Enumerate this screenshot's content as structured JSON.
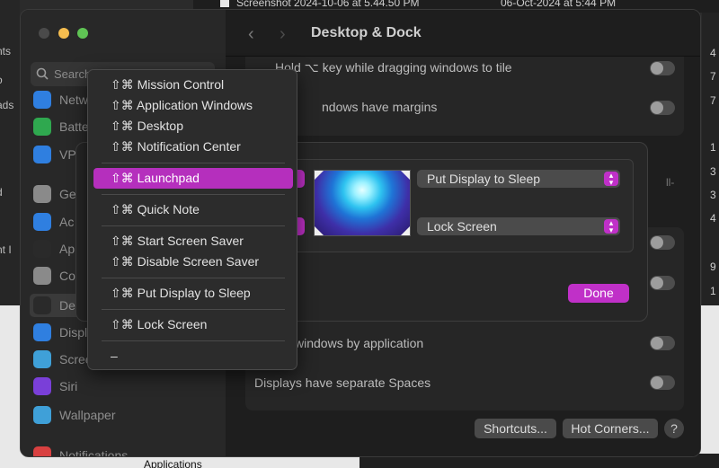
{
  "background": {
    "top_file_name": "Screenshot 2024-10-06 at 5.44.50 PM",
    "top_file_date": "06-Oct-2024 at 5:44 PM",
    "left_fragments": [
      "nts",
      "o",
      "ads",
      "d",
      "nt I"
    ],
    "right_digits": [
      "4",
      "7",
      "7",
      "1",
      "3",
      "3",
      "4",
      "9",
      "1"
    ],
    "applications_label": "Applications"
  },
  "window": {
    "title": "Desktop & Dock",
    "search_placeholder": "Search",
    "sidebar_items": [
      {
        "label": "Netw",
        "color": "#2f7fe0"
      },
      {
        "label": "Batte",
        "color": "#2fa84f"
      },
      {
        "label": "VPN",
        "color": "#2f7fe0"
      },
      {
        "label": "Ge",
        "color": "#8a8a8a"
      },
      {
        "label": "Ac",
        "color": "#2f7fe0"
      },
      {
        "label": "Ap",
        "color": "#2a2a2a"
      },
      {
        "label": "Co",
        "color": "#8a8a8a"
      },
      {
        "label": "De",
        "color": "#2a2a2a"
      },
      {
        "label": "Displ",
        "color": "#2f7fe0"
      },
      {
        "label": "Scree",
        "color": "#3fa0d8"
      },
      {
        "label": "Siri",
        "color": "#7a3fd8"
      },
      {
        "label": "Wallpaper",
        "color": "#3fa0d8"
      },
      {
        "label": "Notifications",
        "color": "#d84040"
      }
    ],
    "settings_rows": {
      "hold_key": "Hold ⌥ key while dragging windows to tile",
      "margins": "ndows have margins",
      "truncated_right": "ll-",
      "group_by_app": "windows by application",
      "separate_spaces": "Displays have separate Spaces"
    },
    "buttons": {
      "shortcuts": "Shortcuts...",
      "hot_corners": "Hot Corners...",
      "help": "?"
    }
  },
  "hot_corners_sheet": {
    "top_right": "Put Display to Sleep",
    "bottom_right": "Lock Screen",
    "done": "Done"
  },
  "menu": {
    "items": [
      "⇧⌘ Mission Control",
      "⇧⌘ Application Windows",
      "⇧⌘ Desktop",
      "⇧⌘ Notification Center",
      "⇧⌘ Launchpad",
      "⇧⌘ Quick Note",
      "⇧⌘ Start Screen Saver",
      "⇧⌘ Disable Screen Saver",
      "⇧⌘ Put Display to Sleep",
      "⇧⌘ Lock Screen",
      "–"
    ],
    "selected_index": 4,
    "accent_color": "#b52fbd"
  }
}
